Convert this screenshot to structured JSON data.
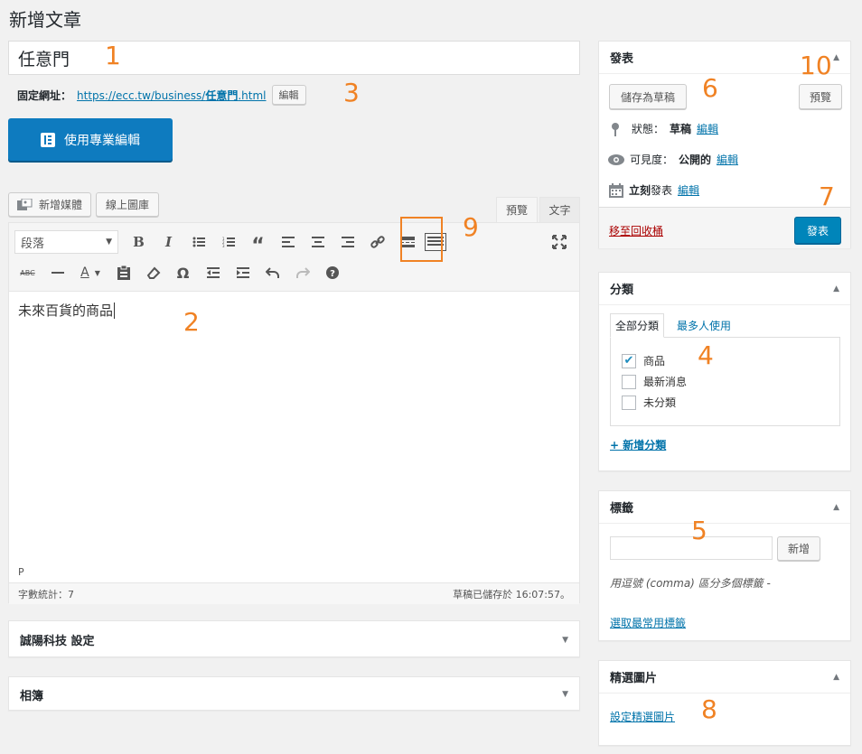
{
  "page_title": "新增文章",
  "post_title": "任意門",
  "permalink": {
    "label": "固定網址：",
    "url_prefix": "https://ecc.tw/business/",
    "slug": "任意門",
    "url_suffix": ".html",
    "edit_label": "編輯"
  },
  "elementor_button": "使用專業編輯",
  "media": {
    "add_media": "新增媒體",
    "gallery": "線上圖庫"
  },
  "editor_tabs": {
    "visual": "預覽",
    "text": "文字"
  },
  "toolbar": {
    "format_value": "段落"
  },
  "content": "未來百貨的商品",
  "status": {
    "path": "P",
    "word_count": "字數統計：7",
    "saved": "草稿已儲存於 16:07:57。"
  },
  "meta_boxes": [
    {
      "title": "誠陽科技 設定"
    },
    {
      "title": "相簿"
    }
  ],
  "publish": {
    "title": "發表",
    "save_draft": "儲存為草稿",
    "preview": "預覽",
    "status_label": "狀態：",
    "status_value": "草稿",
    "visibility_label": "可見度：",
    "visibility_value": "公開的",
    "schedule_bold": "立刻",
    "schedule_text": "發表",
    "edit": "編輯",
    "trash": "移至回收桶",
    "publish_btn": "發表"
  },
  "categories": {
    "title": "分類",
    "tab_all": "全部分類",
    "tab_popular": "最多人使用",
    "items": [
      {
        "label": "商品",
        "checked": true
      },
      {
        "label": "最新消息",
        "checked": false
      },
      {
        "label": "未分類",
        "checked": false
      }
    ],
    "add_new": "+ 新增分類"
  },
  "tags": {
    "title": "標籤",
    "add_btn": "新增",
    "hint": "用逗號 (comma) 區分多個標籤",
    "choose": "選取最常用標籤"
  },
  "featured": {
    "title": "精選圖片",
    "set": "設定精選圖片"
  },
  "annotations": [
    "1",
    "2",
    "3",
    "4",
    "5",
    "6",
    "7",
    "8",
    "9",
    "10"
  ],
  "colors": {
    "accent": "#0073aa",
    "annotation": "#f08224",
    "primary": "#0085ba"
  }
}
